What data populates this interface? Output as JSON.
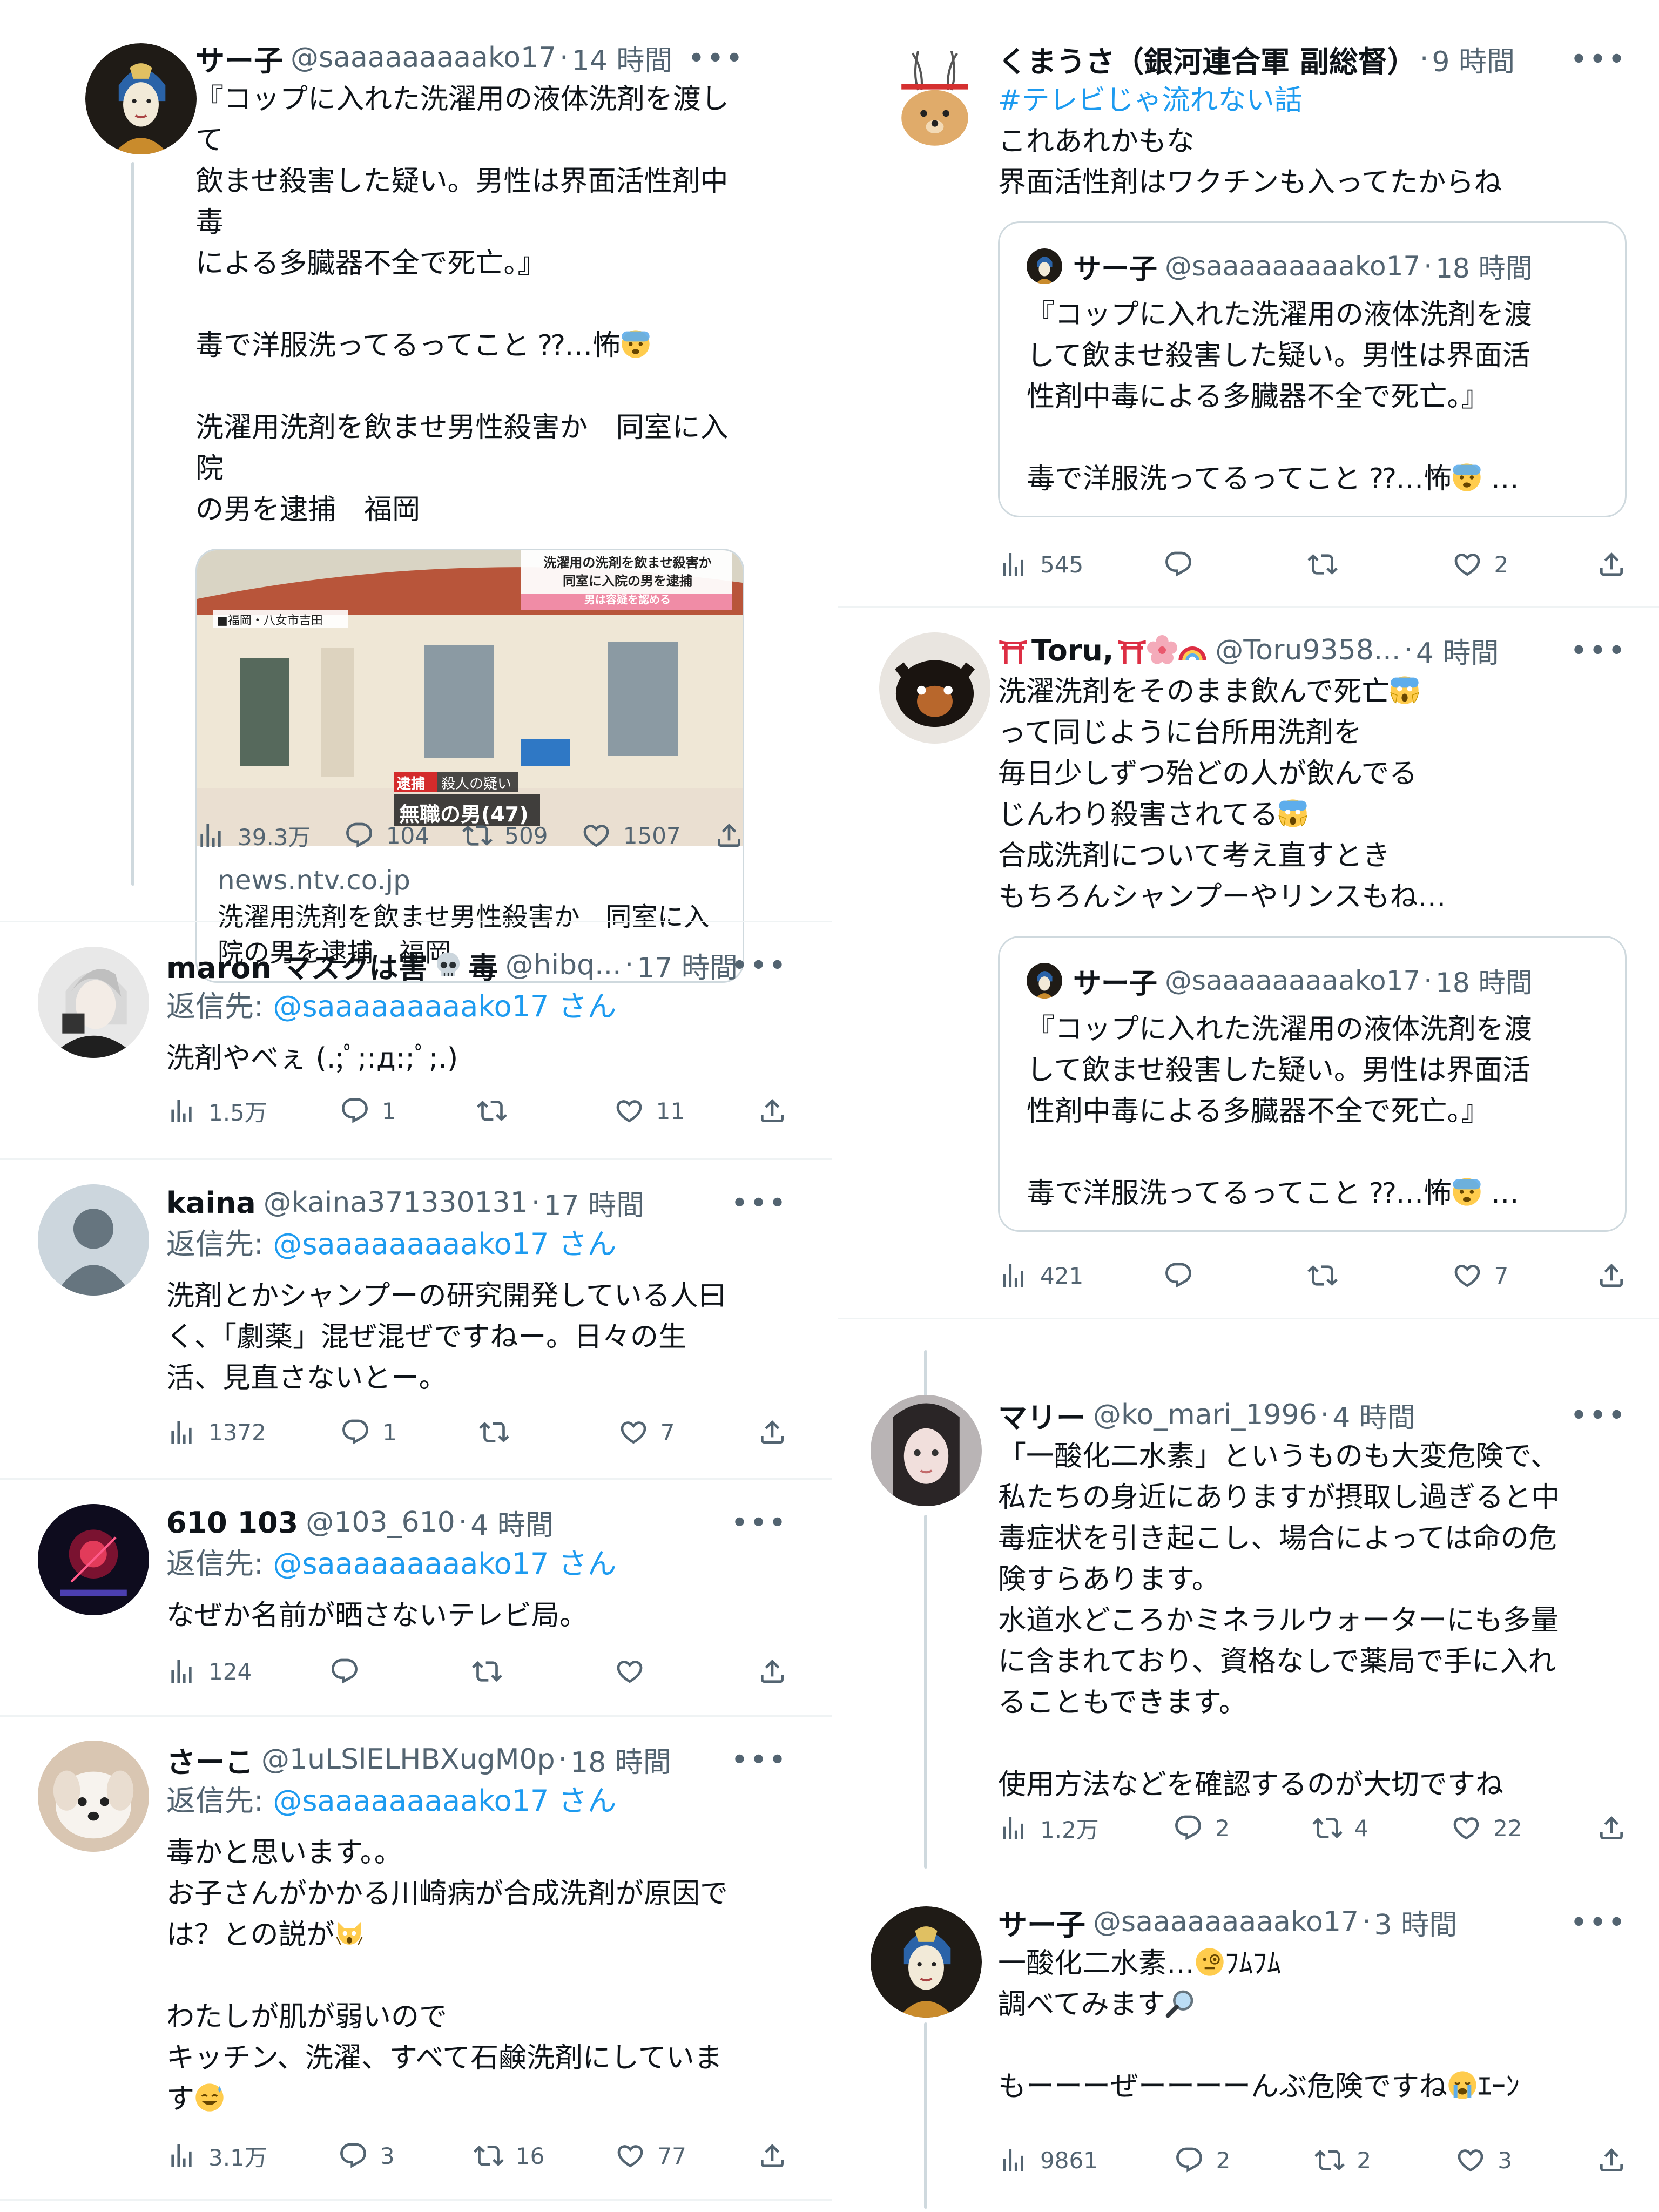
{
  "colors": {
    "accent": "#1d9bf0",
    "secondary": "#536471",
    "divider": "#eff3f4",
    "thread": "#cfd9de"
  },
  "icons": [
    "views-icon",
    "reply-icon",
    "retweet-icon",
    "like-icon",
    "share-icon",
    "more-icon"
  ],
  "left": {
    "main": {
      "name": "サー子",
      "handle": "@saaaaaaaaako17",
      "time": "14 時間",
      "text": "『コップに入れた洗濯用の液体洗剤を渡して\n飲ませ殺害した疑い。男性は界面活性剤中毒\nによる多臓器不全で死亡。』\n\n毒で洋服洗ってるってこと ⁇…怖",
      "text2": "洗濯用洗剤を飲ませ男性殺害か　同室に入院\nの男を逮捕　福岡",
      "card": {
        "overlay_top1": "洗濯用の洗剤を飲ませ殺害か",
        "overlay_top2": "同室に入院の男を逮捕",
        "overlay_top3": "男は容疑を認める",
        "location": "■福岡・八女市吉田",
        "badge": "逮捕",
        "sub1": "殺人の疑い",
        "sub2": "無職の男(47)",
        "domain": "news.ntv.co.jp",
        "title": "洗濯用洗剤を飲ませ男性殺害か　同室に入\n院の男を逮捕　福岡"
      },
      "stats": {
        "views": "39.3万",
        "replies": "104",
        "retweets": "509",
        "likes": "1507"
      }
    },
    "replies": [
      {
        "name": "maron マスクは害",
        "name2": "毒",
        "handle": "@hibq...",
        "time": "17 時間",
        "reply_label": "返信先: ",
        "reply_to": "@saaaaaaaaako17 さん",
        "text": "洗剤やべぇ (.;ﾟ;:д:;ﾟ;.)",
        "stats": {
          "views": "1.5万",
          "replies": "1",
          "retweets": "",
          "likes": "11"
        }
      },
      {
        "name": "kaina",
        "handle": "@kaina371330131",
        "time": "17 時間",
        "reply_label": "返信先: ",
        "reply_to": "@saaaaaaaaako17 さん",
        "text": "洗剤とかシャンプーの研究開発している人曰\nく、「劇薬」混ぜ混ぜですねー。日々の生\n活、見直さないとー。",
        "stats": {
          "views": "1372",
          "replies": "1",
          "retweets": "",
          "likes": "7"
        }
      },
      {
        "name": "610 103",
        "handle": "@103_610",
        "time": "4 時間",
        "reply_label": "返信先: ",
        "reply_to": "@saaaaaaaaako17 さん",
        "text": "なぜか名前が晒さないテレビ局。",
        "stats": {
          "views": "124",
          "replies": "",
          "retweets": "",
          "likes": ""
        }
      },
      {
        "name": "さーこ",
        "handle": "@1uLSlELHBXugM0p",
        "time": "18 時間",
        "reply_label": "返信先: ",
        "reply_to": "@saaaaaaaaako17 さん",
        "text": "毒かと思います。。\nお子さんがかかる川崎病が合成洗剤が原因で\nは？との説が",
        "text2": "わたしが肌が弱いので\nキッチン、洗濯、すべて石鹸洗剤にしていま\nす",
        "stats": {
          "views": "3.1万",
          "replies": "3",
          "retweets": "16",
          "likes": "77"
        }
      }
    ]
  },
  "right": {
    "tweets": [
      {
        "name": "くまうさ（銀河連合軍 副総督）",
        "time": "9 時間",
        "hashtag": "#テレビじゃ流れない話",
        "text": "これあれかもな\n界面活性剤はワクチンも入ってたからね",
        "quote": {
          "name": "サー子",
          "handle": "@saaaaaaaaako17",
          "time": "18 時間",
          "text": "『コップに入れた洗濯用の液体洗剤を渡\nして飲ませ殺害した疑い。男性は界面活\n性剤中毒による多臓器不全で死亡。』\n\n毒で洋服洗ってるってこと ⁇…怖",
          "ellipsis": " …"
        },
        "stats": {
          "views": "545",
          "replies": "",
          "retweets": "",
          "likes": "2"
        }
      },
      {
        "name": "Toru,",
        "handle": "@Toru9358...",
        "time": "4 時間",
        "text": "洗濯洗剤をそのまま飲んで死亡",
        "text_b": "って同じように台所用洗剤を\n毎日少しずつ殆どの人が飲んでる\nじんわり殺害されてる",
        "text_c": "合成洗剤について考え直すとき\nもちろんシャンプーやリンスもね…",
        "quote": {
          "name": "サー子",
          "handle": "@saaaaaaaaako17",
          "time": "18 時間",
          "text": "『コップに入れた洗濯用の液体洗剤を渡\nして飲ませ殺害した疑い。男性は界面活\n性剤中毒による多臓器不全で死亡。』\n\n毒で洋服洗ってるってこと ⁇…怖",
          "ellipsis": " …"
        },
        "stats": {
          "views": "421",
          "replies": "",
          "retweets": "",
          "likes": "7"
        }
      },
      {
        "name": "マリー",
        "handle": "@ko_mari_1996",
        "time": "4 時間",
        "text": "「一酸化二水素」というものも大変危険で、\n私たちの身近にありますが摂取し過ぎると中\n毒症状を引き起こし、場合によっては命の危\n険すらあります。\n水道水どころかミネラルウォーターにも多量\nに含まれており、資格なしで薬局で手に入れ\nることもできます。\n\n使用方法などを確認するのが大切ですね",
        "stats": {
          "views": "1.2万",
          "replies": "2",
          "retweets": "4",
          "likes": "22"
        }
      },
      {
        "name": "サー子",
        "handle": "@saaaaaaaaako17",
        "time": "3 時間",
        "text_a": "一酸化二水素…",
        "text_a2": "ﾌﾑﾌﾑ",
        "text_b": "調べてみます",
        "text_c": "もーーーぜーーーーんぶ危険ですね",
        "text_c2": "ｴｰﾝ",
        "stats": {
          "views": "9861",
          "replies": "2",
          "retweets": "2",
          "likes": "3"
        }
      }
    ]
  }
}
